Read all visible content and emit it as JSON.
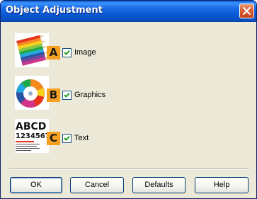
{
  "window": {
    "title": "Object Adjustment",
    "close_icon": "close-icon"
  },
  "options": [
    {
      "letter": "A",
      "label": "Image",
      "checked": true,
      "thumbnail_icon": "colored-pencils-icon"
    },
    {
      "letter": "B",
      "label": "Graphics",
      "checked": true,
      "thumbnail_icon": "pie-chart-icon"
    },
    {
      "letter": "C",
      "label": "Text",
      "checked": true,
      "thumbnail_icon": "text-sample-icon"
    }
  ],
  "thumbnail_text": {
    "line1": "ABCD",
    "line2": "1234567"
  },
  "buttons": {
    "ok": "OK",
    "cancel": "Cancel",
    "defaults": "Defaults",
    "help": "Help"
  },
  "colors": {
    "titlebar": "#0a5bd6",
    "badge": "#f5a021",
    "dialog_bg": "#ece9d8",
    "close_button": "#d95e34"
  }
}
